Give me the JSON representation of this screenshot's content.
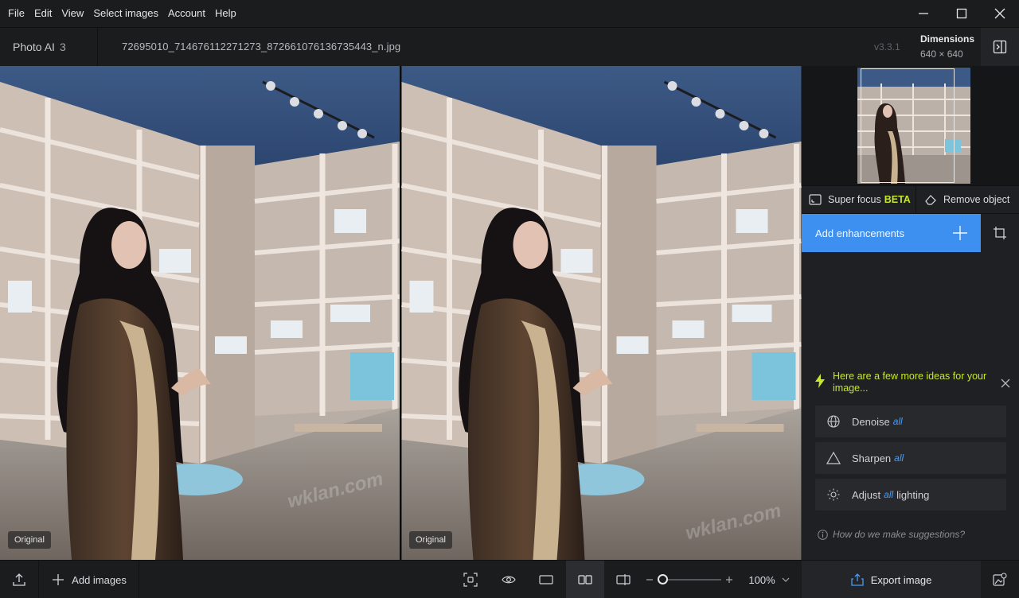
{
  "menubar": {
    "items": [
      "File",
      "Edit",
      "View",
      "Select images",
      "Account",
      "Help"
    ]
  },
  "window_controls": [
    "minimize-icon",
    "maximize-icon",
    "close-icon"
  ],
  "header": {
    "app_name": "Photo AI",
    "image_count": "3",
    "filename": "72695010_714676112271273_872661076136735443_n.jpg",
    "version": "v3.3.1",
    "dimensions_label": "Dimensions",
    "dimensions_value": "640 × 640"
  },
  "viewer": {
    "left_label": "Original",
    "right_label": "Original"
  },
  "panel": {
    "super_focus_label": "Super focus",
    "super_focus_badge": "BETA",
    "remove_object_label": "Remove object",
    "add_enhancements_label": "Add enhancements",
    "ideas_title": "Here are a few more ideas for your image...",
    "ideas": [
      {
        "icon": "globe-icon",
        "before": "Denoise",
        "highlight": "all",
        "after": ""
      },
      {
        "icon": "triangle-icon",
        "before": "Sharpen",
        "highlight": "all",
        "after": ""
      },
      {
        "icon": "sun-icon",
        "before": "Adjust",
        "highlight": "all",
        "after": "lighting"
      }
    ],
    "suggestion_link": "How do we make suggestions?"
  },
  "bottombar": {
    "add_images_label": "Add images",
    "zoom_value": "100%",
    "export_label": "Export image"
  },
  "colors": {
    "accent_blue": "#3d8ff0",
    "highlight_green": "#c8e62c",
    "background": "#1b1c1e"
  }
}
